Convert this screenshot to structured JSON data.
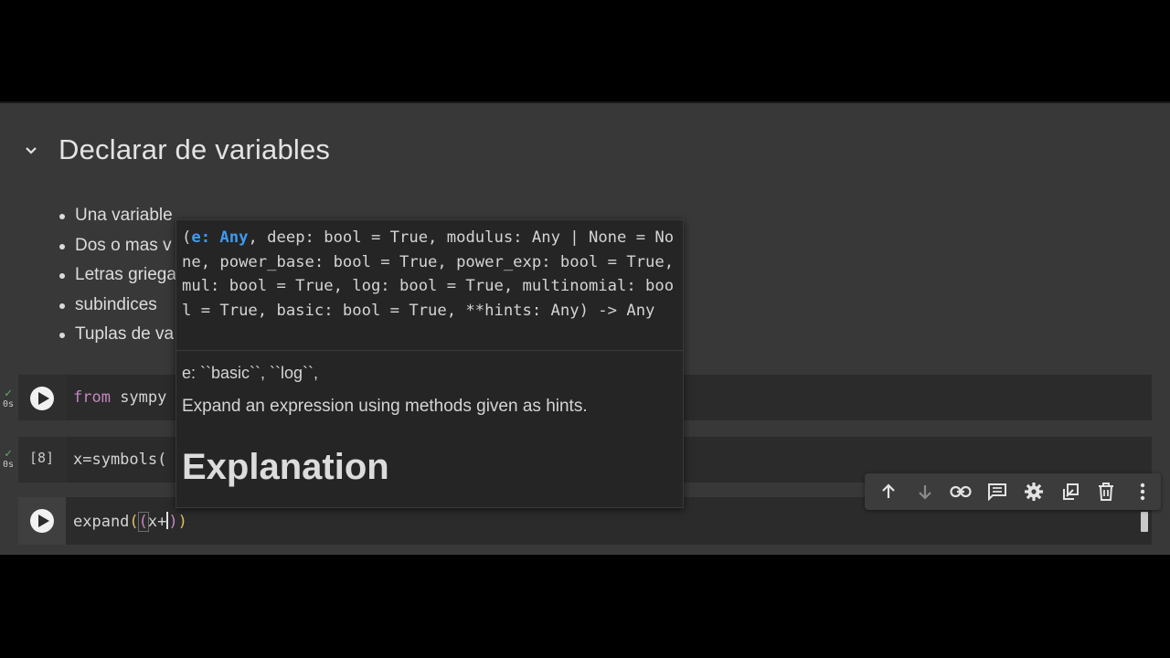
{
  "section": {
    "heading": "Declarar de variables",
    "bullets": [
      "Una variable",
      "Dos o mas v",
      "Letras griega",
      "subindices",
      "Tuplas de va"
    ]
  },
  "cells": [
    {
      "status_time": "0s",
      "code_keyword": "from",
      "code_rest": " sympy"
    },
    {
      "exec_count": "[8]",
      "status_time": "0s",
      "code": "x=symbols("
    }
  ],
  "active_cell": {
    "code_prefix": "expand",
    "paren_open_1": "(",
    "paren_open_2": "(",
    "code_mid": "x+",
    "paren_close_2": ")",
    "paren_close_1": ")"
  },
  "toolbar": {
    "icons": [
      "arrow-up-icon",
      "arrow-down-icon",
      "link-icon",
      "comment-icon",
      "gear-icon",
      "mirror-cell-icon",
      "trash-icon",
      "more-vert-icon"
    ]
  },
  "tooltip": {
    "sig_open": "(",
    "sig_param": "e: Any",
    "sig_rest": ", deep: bool = True, modulus: Any | None = None, power_base: bool = True, power_exp: bool = True, mul: bool = True, log: bool = True, multinomial: bool = True, basic: bool = True, **hints: Any) -> Any",
    "doc_line1": "e: ``basic``, ``log``,",
    "doc_line2": "Expand an expression using methods given as hints.",
    "doc_heading": "Explanation"
  },
  "colors": {
    "background": "#383838",
    "cell_bg": "#2b2b2b",
    "keyword": "#c586c0",
    "param_highlight": "#3d9bf0",
    "status_ok": "#5fb364"
  }
}
